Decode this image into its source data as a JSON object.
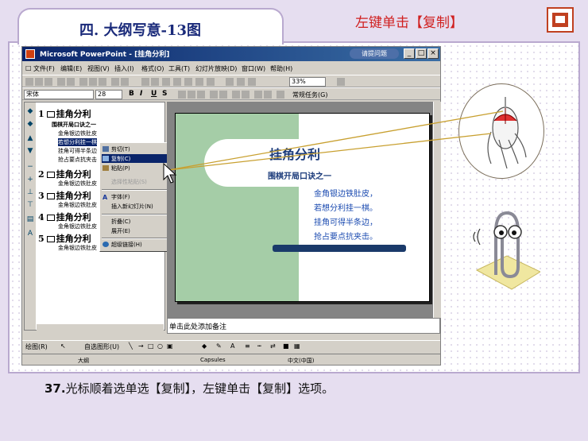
{
  "header": {
    "title": "四. 大纲写意-13图",
    "hint": "左键单击【复制】"
  },
  "caption": {
    "number": "37.",
    "text": "光标顺着选单选【复制】，左键单击【复制】选项。"
  },
  "window": {
    "title": "Microsoft PowerPoint - [挂角分利]",
    "help_text": "请提问题",
    "menus": [
      "文件(F)",
      "编辑(E)",
      "视图(V)",
      "插入(I)",
      "格式(O)",
      "工具(T)",
      "幻灯片放映(D)",
      "窗口(W)",
      "帮助(H)"
    ],
    "zoom": "33%",
    "font_name": "宋体",
    "font_size": "28",
    "format_buttons": [
      "B",
      "I",
      "U",
      "S"
    ],
    "task_pane_label": "常规任务(G)"
  },
  "outline": {
    "slides": [
      {
        "num": "1",
        "title": "挂角分利",
        "subs": [
          "围棋开局口诀之一",
          "金角银边铁肚皮",
          "若想分利挂一棋",
          "挂角可得半条边",
          "抢占要点抗夹击"
        ]
      },
      {
        "num": "2",
        "title": "挂角分利",
        "subs": [
          "金角银边铁肚皮"
        ]
      },
      {
        "num": "3",
        "title": "挂角分利",
        "subs": [
          "金角银边铁肚皮"
        ]
      },
      {
        "num": "4",
        "title": "挂角分利",
        "subs": [
          "金角银边铁肚皮"
        ]
      },
      {
        "num": "5",
        "title": "挂角分利",
        "subs": [
          "金角银边铁肚皮"
        ]
      }
    ]
  },
  "context_menu": {
    "cut": "剪切(T)",
    "copy": "复制(C)",
    "paste": "粘贴(P)",
    "paste_special": "选择性粘贴(S)",
    "font": "字体(F)",
    "insert_comment": "插入新幻灯片(N)",
    "collapse": "折叠(C)",
    "expand": "展开(E)",
    "hyperlink": "超级链接(H)"
  },
  "slide": {
    "title": "挂角分利",
    "subtitle": "围棋开局口诀之一",
    "body": [
      "金角银边铁肚皮，",
      "若想分利挂一棋。",
      "挂角可得半条边，",
      "抢占要点抗夹击。"
    ]
  },
  "notes_placeholder": "单击此处添加备注",
  "drawing_toolbar": {
    "draw": "绘图(R)",
    "autoshapes": "自选图形(U)"
  },
  "status_bar": {
    "slide_label": "大纲",
    "design": "Capsules",
    "language": "中文(中国)"
  },
  "colors": {
    "accent_red": "#d02020",
    "title_blue": "#1a2a7a",
    "slide_green": "#a5cda7"
  }
}
